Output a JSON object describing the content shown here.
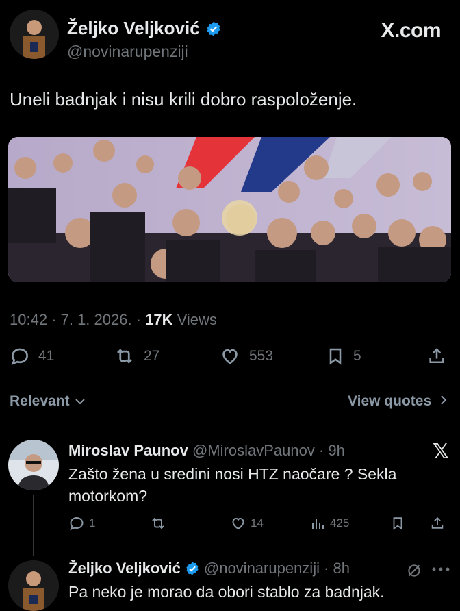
{
  "header": {
    "name": "Željko Veljković",
    "handle": "@novinarupenziji",
    "site": "X.com"
  },
  "tweet": {
    "text": "Uneli badnjak i nisu krili dobro raspoloženje.",
    "time_date": "10:42 · 7. 1. 2026. · ",
    "views_count": "17K",
    "views_label": " Views"
  },
  "actions": {
    "replies": "41",
    "reposts": "27",
    "likes": "553",
    "bookmarks": "5"
  },
  "sort": {
    "relevant": "Relevant",
    "view_quotes": "View quotes"
  },
  "reply1": {
    "name": "Miroslav Paunov",
    "handle": "@MiroslavPaunov · 9h",
    "text_line1": "Zašto žena u sredini nosi HTZ naočare ? Sekla",
    "text_line2": "motorkom?",
    "replies": "1",
    "likes": "14",
    "views": "425"
  },
  "reply2": {
    "name": "Željko Veljković",
    "handle": "@novinarupenziji · 8h",
    "text": "Pa neko je morao da obori stablo za badnjak."
  },
  "colors": {
    "background": "#000000",
    "text": "#e7e9ea",
    "muted": "#71767b",
    "verified": "#1d9bf0"
  }
}
